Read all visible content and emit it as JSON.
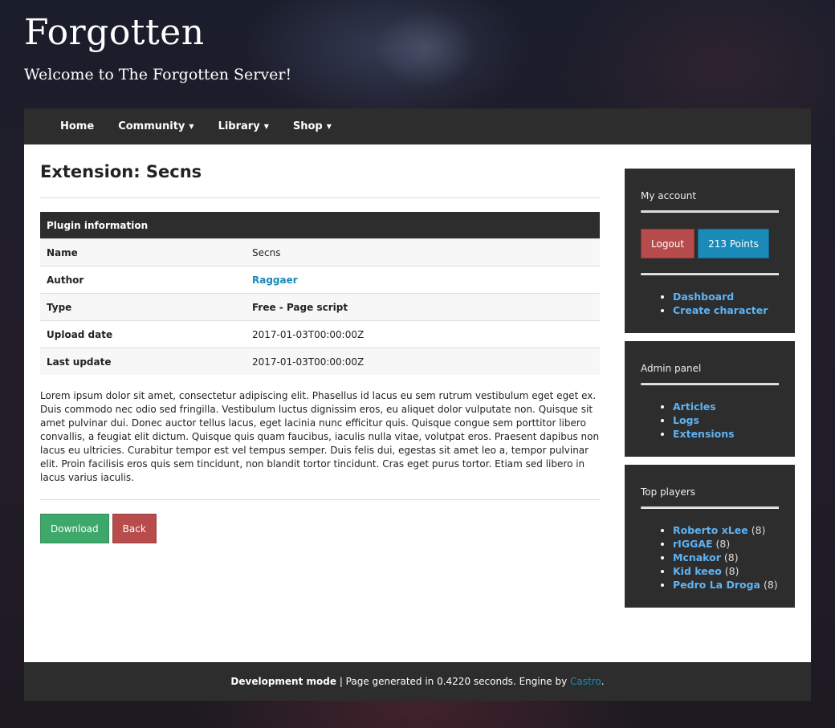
{
  "site": {
    "title": "Forgotten",
    "tagline": "Welcome to The Forgotten Server!"
  },
  "nav": {
    "items": [
      {
        "label": "Home",
        "dropdown": false
      },
      {
        "label": "Community",
        "dropdown": true
      },
      {
        "label": "Library",
        "dropdown": true
      },
      {
        "label": "Shop",
        "dropdown": true
      }
    ]
  },
  "main": {
    "title": "Extension: Secns",
    "table": {
      "header": "Plugin information",
      "rows": [
        {
          "label": "Name",
          "value": "Secns"
        },
        {
          "label": "Author",
          "value": "Raggaer"
        },
        {
          "label": "Type",
          "value": "Free - Page script"
        },
        {
          "label": "Upload date",
          "value": "2017-01-03T00:00:00Z"
        },
        {
          "label": "Last update",
          "value": "2017-01-03T00:00:00Z"
        }
      ]
    },
    "description": "Lorem ipsum dolor sit amet, consectetur adipiscing elit. Phasellus id lacus eu sem rutrum vestibulum eget eget ex. Duis commodo nec odio sed fringilla. Vestibulum luctus dignissim eros, eu aliquet dolor vulputate non. Quisque sit amet pulvinar dui. Donec auctor tellus lacus, eget lacinia nunc efficitur quis. Quisque congue sem porttitor libero convallis, a feugiat elit dictum. Quisque quis quam faucibus, iaculis nulla vitae, volutpat eros. Praesent dapibus non lacus eu ultricies. Curabitur tempor est vel tempus semper. Duis felis dui, egestas sit amet leo a, tempor pulvinar elit. Proin facilisis eros quis sem tincidunt, non blandit tortor tincidunt. Cras eget purus tortor. Etiam sed libero in lacus varius iaculis.",
    "download_label": "Download",
    "back_label": "Back"
  },
  "sidebar": {
    "account": {
      "title": "My account",
      "logout_label": "Logout",
      "points_label": "213 Points",
      "links": [
        "Dashboard",
        "Create character"
      ]
    },
    "admin": {
      "title": "Admin panel",
      "links": [
        "Articles",
        "Logs",
        "Extensions"
      ]
    },
    "top_players": {
      "title": "Top players",
      "players": [
        {
          "name": "Roberto xLee",
          "count": "(8)"
        },
        {
          "name": "rIGGAE",
          "count": "(8)"
        },
        {
          "name": "Mcnakor",
          "count": "(8)"
        },
        {
          "name": "Kid keeo",
          "count": "(8)"
        },
        {
          "name": "Pedro La Droga",
          "count": "(8)"
        }
      ]
    }
  },
  "footer": {
    "mode": "Development mode",
    "separator": " | Page generated in 0.4220 seconds. Engine by ",
    "engine": "Castro",
    "end": "."
  },
  "colors": {
    "accent": "#1a8ab8",
    "link_dark": "#5fb3f3",
    "success": "#3da86a",
    "danger": "#b84c4c",
    "dark": "#2d2d2d"
  }
}
